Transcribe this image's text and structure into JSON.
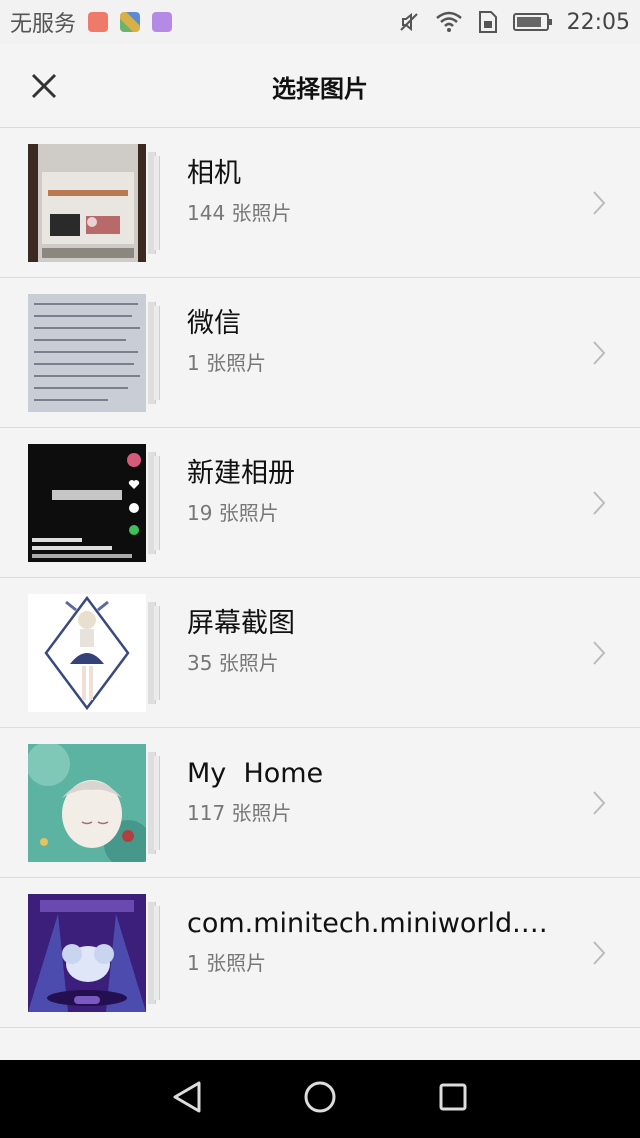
{
  "status_bar": {
    "carrier": "无服务",
    "time": "22:05",
    "icons": [
      "mail-app-icon",
      "gallery-app-icon",
      "photo-app-icon",
      "mute-icon",
      "wifi-icon",
      "sim-icon",
      "battery-icon"
    ]
  },
  "header": {
    "title": "选择图片",
    "close_icon": "close-icon"
  },
  "albums": [
    {
      "name": "相机",
      "count": "144 张照片"
    },
    {
      "name": "微信",
      "count": "1 张照片"
    },
    {
      "name": "新建相册",
      "count": "19 张照片"
    },
    {
      "name": "屏幕截图",
      "count": "35 张照片"
    },
    {
      "name": "My  Home",
      "count": "117 张照片"
    },
    {
      "name": "com.minitech.miniworld.hu...",
      "count": "1 张照片"
    }
  ],
  "nav_bar": {
    "icons": [
      "back-triangle-icon",
      "home-circle-icon",
      "recents-square-icon"
    ]
  },
  "colors": {
    "background": "#f4f4f4",
    "divider": "#dcdcdc",
    "nav_bar": "#000000",
    "secondary_text": "#777777"
  }
}
